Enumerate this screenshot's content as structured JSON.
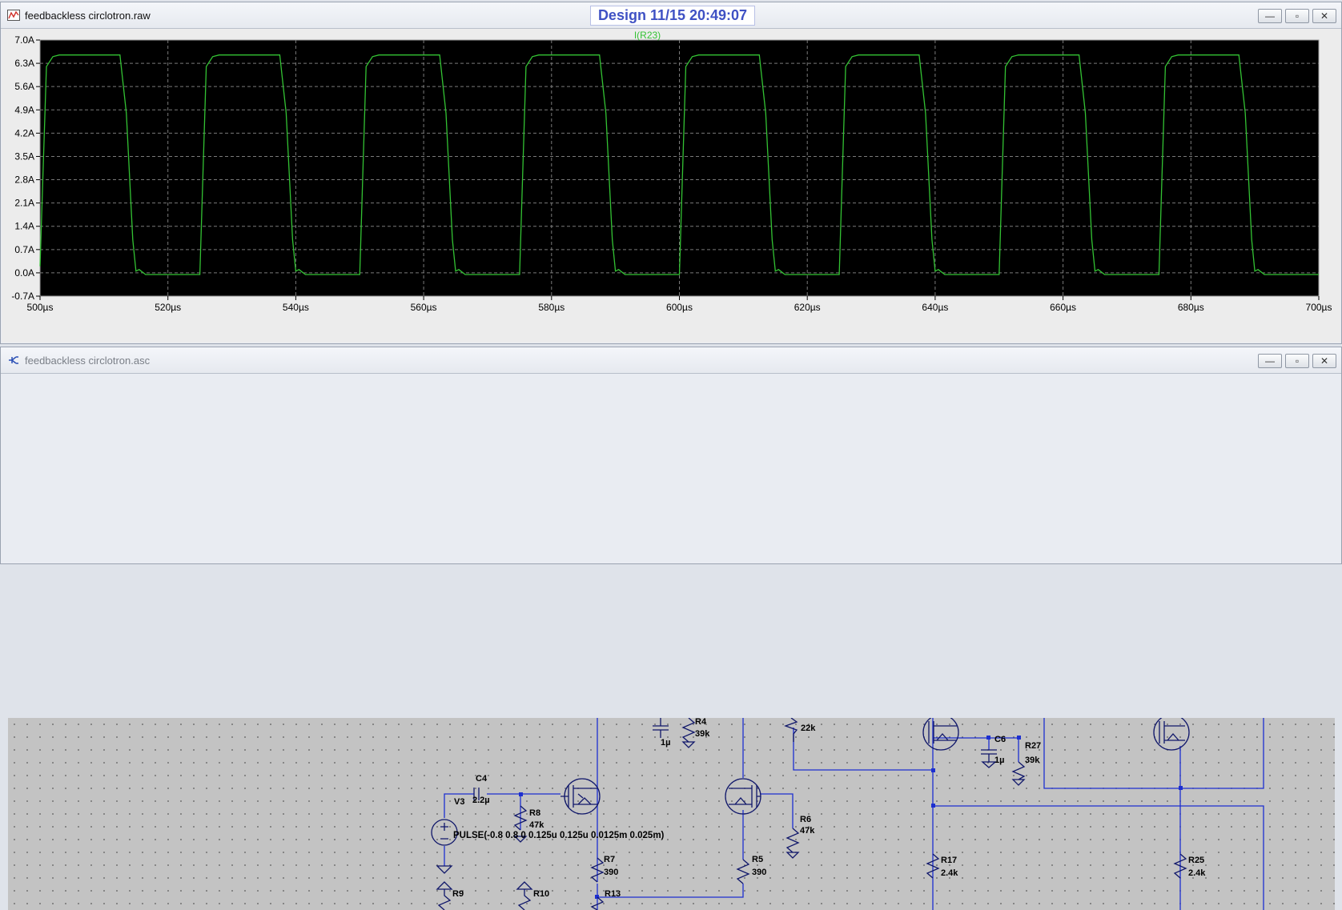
{
  "waveform_window": {
    "title": "feedbackless circlotron.raw",
    "timestamp": "Design  11/15  20:49:07"
  },
  "schematic_window": {
    "title": "feedbackless circlotron.asc",
    "components": [
      {
        "ref": "C4",
        "value": "2.2µ"
      },
      {
        "ref": "V3",
        "value": ""
      },
      {
        "ref": "R8",
        "value": "47k"
      },
      {
        "ref": "R4",
        "value": "39k"
      },
      {
        "ref": "R6",
        "value": "47k"
      },
      {
        "ref": "R5",
        "value": "390"
      },
      {
        "ref": "R7",
        "value": "390"
      },
      {
        "ref": "C6",
        "value": "1µ"
      },
      {
        "ref": "R27",
        "value": "39k"
      },
      {
        "ref": "R17",
        "value": "2.4k"
      },
      {
        "ref": "R25",
        "value": "2.4k"
      },
      {
        "ref": "R9",
        "value": ""
      },
      {
        "ref": "R10",
        "value": ""
      },
      {
        "ref": "R13",
        "value": ""
      }
    ],
    "labels": {
      "cap_top_value": "1µ",
      "resistor_22k": "22k",
      "v3_pulse": "PULSE(-0.8 0.8 0 0.125u 0.125u 0.0125m 0.025m)"
    }
  },
  "window_buttons": {
    "minimize": "—",
    "restore": "▫",
    "close": "✕"
  },
  "chart_data": {
    "type": "line",
    "title": "I(R23)",
    "xlabel": "",
    "ylabel": "",
    "x_ticks": [
      "500µs",
      "520µs",
      "540µs",
      "560µs",
      "580µs",
      "600µs",
      "620µs",
      "640µs",
      "660µs",
      "680µs",
      "700µs"
    ],
    "y_ticks": [
      "-0.7A",
      "0.0A",
      "0.7A",
      "1.4A",
      "2.1A",
      "2.8A",
      "3.5A",
      "4.2A",
      "4.9A",
      "5.6A",
      "6.3A",
      "7.0A"
    ],
    "xlim": [
      500,
      700
    ],
    "ylim": [
      -0.7,
      7.0
    ],
    "grid": true,
    "background": "#000000",
    "trace_color": "#33c233",
    "grid_color": "#7a7a7a",
    "series": [
      {
        "name": "I(R23)",
        "x": [
          500,
          501,
          502,
          503,
          512.5,
          513.5,
          514.5,
          515,
          515.5,
          516.5,
          525,
          526,
          527,
          528,
          537.5,
          538.5,
          539.5,
          540,
          540.5,
          541.5,
          550,
          551,
          552,
          553,
          562.5,
          563.5,
          564.5,
          565,
          565.5,
          566.5,
          575,
          576,
          577,
          578,
          587.5,
          588.5,
          589.5,
          590,
          590.5,
          591.5,
          600,
          601,
          602,
          603,
          612.5,
          613.5,
          614.5,
          615,
          615.5,
          616.5,
          625,
          626,
          627,
          628,
          637.5,
          638.5,
          639.5,
          640,
          640.5,
          641.5,
          650,
          651,
          652,
          653,
          662.5,
          663.5,
          664.5,
          665,
          665.5,
          666.5,
          675,
          676,
          677,
          678,
          687.5,
          688.5,
          689.5,
          690,
          690.5,
          691.5,
          700
        ],
        "y": [
          0.2,
          6.2,
          6.5,
          6.55,
          6.55,
          4.8,
          1.0,
          0.05,
          0.1,
          -0.05,
          -0.05,
          6.2,
          6.5,
          6.55,
          6.55,
          4.8,
          1.0,
          0.05,
          0.1,
          -0.05,
          -0.05,
          6.2,
          6.5,
          6.55,
          6.55,
          4.8,
          1.0,
          0.05,
          0.1,
          -0.05,
          -0.05,
          6.2,
          6.5,
          6.55,
          6.55,
          4.8,
          1.0,
          0.05,
          0.1,
          -0.05,
          -0.05,
          6.2,
          6.5,
          6.55,
          6.55,
          4.8,
          1.0,
          0.05,
          0.1,
          -0.05,
          -0.05,
          6.2,
          6.5,
          6.55,
          6.55,
          4.8,
          1.0,
          0.05,
          0.1,
          -0.05,
          -0.05,
          6.2,
          6.5,
          6.55,
          6.55,
          4.8,
          1.0,
          0.05,
          0.1,
          -0.05,
          -0.05,
          6.2,
          6.5,
          6.55,
          6.55,
          4.8,
          1.0,
          0.05,
          0.1,
          -0.05,
          -0.05
        ]
      }
    ]
  }
}
